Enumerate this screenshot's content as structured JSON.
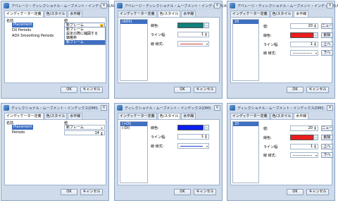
{
  "colors": {
    "teal": "#127f7a",
    "red": "#ec1c1c",
    "blue": "#0b1ff0",
    "accent": "#3f6fc1"
  },
  "common": {
    "tab_settings": "インディケーター定義",
    "tab_color": "色/スタイル",
    "tab_level": "水平線",
    "ok": "OK",
    "cancel": "キャンセル",
    "close": "×",
    "lbl_color": "線色:",
    "lbl_width": "ライン幅:",
    "lbl_style": "線 様式:",
    "lbl_value": "値:",
    "btn_new": "ニュー",
    "btn_delete": "削除",
    "btn_up": "上へ",
    "btn_down": "下へ",
    "name_header": "名前",
    "value_header": "値"
  },
  "adx": {
    "title": "アベレージ・ディレクショナル・ムーブメント・インデックス(ADX)",
    "rows": [
      {
        "name": "Placement",
        "value": "新フレーム"
      },
      {
        "name": "DX Periods",
        "value": "14"
      },
      {
        "name": "ADX Smoothing Periods",
        "value": "14"
      }
    ],
    "dropdown": [
      "新フレーム",
      "設定の際に縮図する",
      "価格枠",
      "新フレーム"
    ],
    "lines": [
      "(ADX)"
    ],
    "width": "1",
    "level": {
      "items": [
        "20"
      ],
      "value": "20",
      "width": "1"
    }
  },
  "dmi": {
    "title": "ディレクショナル・ムーブメント・インデックス(DMI)",
    "rows": [
      {
        "name": "Placement",
        "value": "新フレーム"
      },
      {
        "name": "Periods",
        "value": "14"
      }
    ],
    "lines": [
      "(+DI)",
      "(-DI)"
    ],
    "width": "1",
    "level": {
      "items": [
        "20"
      ],
      "value": "20",
      "width": "1"
    }
  }
}
